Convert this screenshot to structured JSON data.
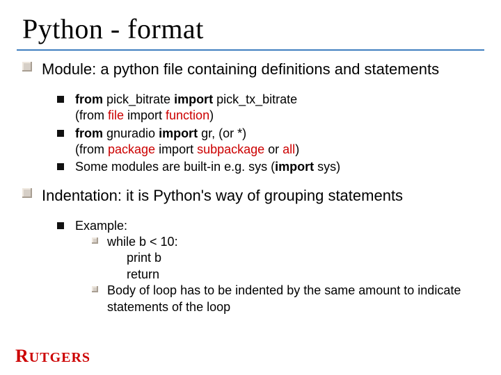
{
  "title": "Python - format",
  "module": {
    "heading": "Module: a python file containing definitions and statements",
    "items": [
      {
        "line1": {
          "pre": "",
          "kw1": "from",
          "mid1": " pick_bitrate ",
          "kw2": "import",
          "mid2": " pick_tx_bitrate"
        },
        "line2": {
          "open": "(from ",
          "red1": "file",
          "mid": " import ",
          "red2": "function",
          "close": ")"
        }
      },
      {
        "line1": {
          "kw1": "from",
          "mid1": " gnuradio ",
          "kw2": "import",
          "mid2": " gr, (or *)"
        },
        "line2": {
          "open": "(from ",
          "red1": "package",
          "mid": " import ",
          "red2": "subpackage",
          "alt": " or ",
          "red3": "all",
          "close": ")"
        }
      },
      {
        "plain_pre": "Some modules are built-in e.g. sys (",
        "kw": "import",
        "plain_post": " sys)"
      }
    ]
  },
  "indent": {
    "heading": "Indentation: it is Python's way of grouping statements",
    "example_label": "Example:",
    "while_line": "while b < 10:",
    "body1": "print b",
    "body2": "return",
    "note": "Body of loop has to be indented by the same amount to indicate statements of the loop"
  },
  "logo": {
    "r": "R",
    "rest": "UTGERS"
  }
}
